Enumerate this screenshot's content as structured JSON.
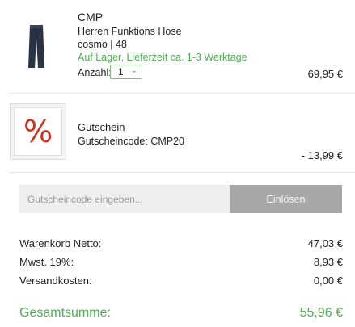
{
  "product": {
    "brand": "CMP",
    "name": "Herren Funktions Hose",
    "variant": "cosmo | 48",
    "stock": "Auf Lager, Lieferzeit ca. 1-3 Werktage",
    "qty_label": "Anzahl:",
    "qty_value": "1",
    "price": "69,95 €",
    "image_icon": "pants-icon"
  },
  "voucher": {
    "symbol": "%",
    "title": "Gutschein",
    "code_line": "Gutscheincode: CMP20",
    "amount": "- 13,99 €"
  },
  "coupon": {
    "placeholder": "Gutscheincode eingeben...",
    "button_label": "Einlösen"
  },
  "summary": {
    "net_label": "Warenkorb Netto:",
    "net_value": "47,03 €",
    "tax_label": "Mwst. 19%:",
    "tax_value": "8,93 €",
    "shipping_label": "Versandkosten:",
    "shipping_value": "0,00 €",
    "total_label": "Gesamtsumme:",
    "total_value": "55,96 €"
  },
  "colors": {
    "accent_green": "#4caf50",
    "voucher_red": "#d32f1f",
    "button_gray": "#a8a8a8"
  }
}
